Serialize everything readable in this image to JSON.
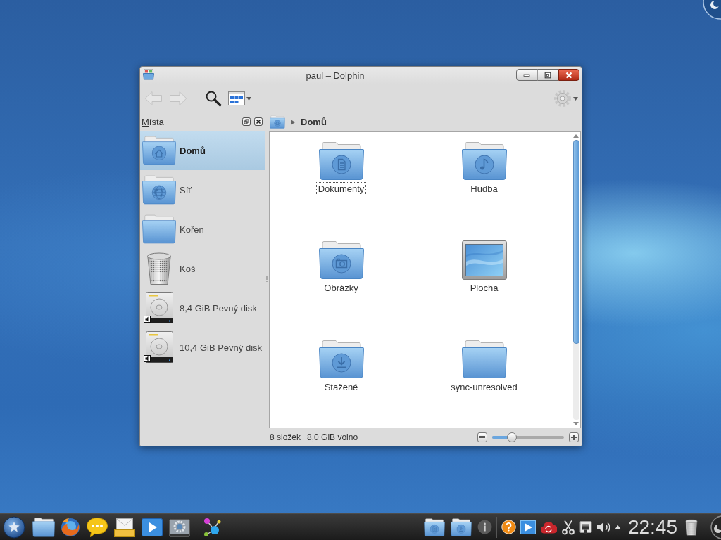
{
  "window": {
    "title": "paul – Dolphin"
  },
  "toolbar": {
    "buttons": [
      {
        "kind": "back",
        "disabled": true
      },
      {
        "kind": "forward",
        "disabled": true
      },
      {
        "kind": "search",
        "disabled": false
      },
      {
        "kind": "view-mode",
        "disabled": false
      }
    ]
  },
  "places": {
    "title": "Místa",
    "items": [
      {
        "kind": "home",
        "label": "Domů",
        "selected": true
      },
      {
        "kind": "network",
        "label": "Síť",
        "selected": false
      },
      {
        "kind": "folder",
        "label": "Kořen",
        "selected": false
      },
      {
        "kind": "trash",
        "label": "Koš",
        "selected": false
      },
      {
        "kind": "disk",
        "label": "8,4 GiB Pevný disk",
        "selected": false
      },
      {
        "kind": "disk",
        "label": "10,4 GiB Pevný disk",
        "selected": false
      }
    ]
  },
  "breadcrumb": {
    "location": "Domů"
  },
  "files": [
    {
      "kind": "documents",
      "name": "Dokumenty",
      "selected": false,
      "focused": true
    },
    {
      "kind": "music",
      "name": "Hudba",
      "selected": false,
      "focused": false
    },
    {
      "kind": "pictures",
      "name": "Obrázky",
      "selected": false,
      "focused": false
    },
    {
      "kind": "desktop",
      "name": "Plocha",
      "selected": false,
      "focused": false
    },
    {
      "kind": "downloads",
      "name": "Stažené",
      "selected": false,
      "focused": false
    },
    {
      "kind": "folder",
      "name": "sync-unresolved",
      "selected": false,
      "focused": false
    }
  ],
  "status_bar": {
    "folders": "8 složek",
    "free_space": "8,0 GiB volno",
    "zoom": {
      "level": 0.27
    }
  },
  "taskbar": {
    "launchers": [
      {
        "kind": "menu"
      },
      {
        "kind": "folder"
      },
      {
        "kind": "browser"
      },
      {
        "kind": "chat"
      },
      {
        "kind": "mail"
      },
      {
        "kind": "media"
      },
      {
        "kind": "settings"
      },
      {
        "kind": "activities"
      }
    ],
    "tasks": [
      {
        "kind": "documents"
      },
      {
        "kind": "downloads"
      }
    ],
    "tray": [
      {
        "kind": "info"
      },
      {
        "kind": "help"
      },
      {
        "kind": "media"
      },
      {
        "kind": "sync"
      },
      {
        "kind": "clipboard"
      },
      {
        "kind": "network"
      },
      {
        "kind": "volume"
      },
      {
        "kind": "expand"
      }
    ],
    "clock": "22:45"
  }
}
